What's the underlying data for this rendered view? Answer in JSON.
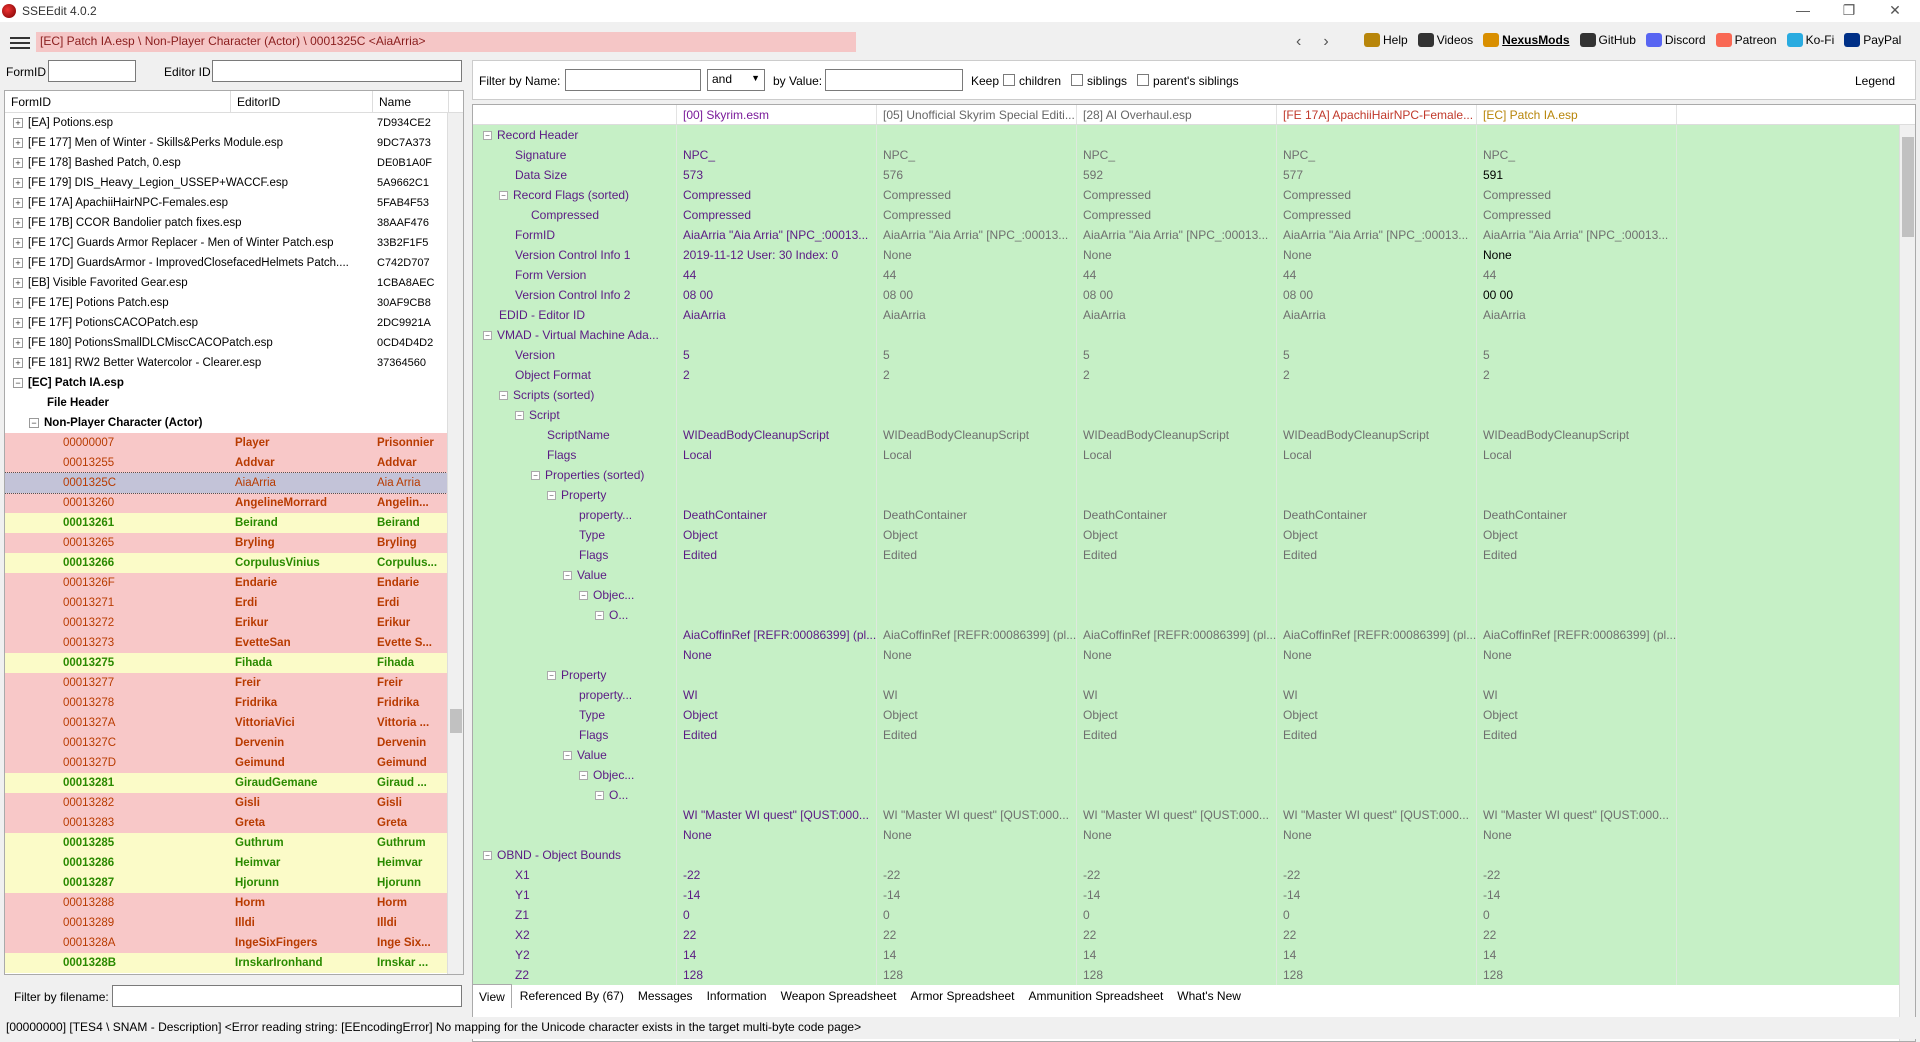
{
  "window": {
    "title": "SSEEdit 4.0.2",
    "min": "—",
    "max": "❐",
    "close": "✕"
  },
  "toolbar": {
    "path": "[EC] Patch IA.esp \\ Non-Player Character (Actor) \\ 0001325C <AiaArria>",
    "back": "‹",
    "forward": "›",
    "links": [
      {
        "label": "Help",
        "icon": "book-icon",
        "color": "#b8860b"
      },
      {
        "label": "Videos",
        "icon": "video-icon",
        "color": "#333"
      },
      {
        "label": "NexusMods",
        "icon": "nexus-icon",
        "color": "#d98f00"
      },
      {
        "label": "GitHub",
        "icon": "github-icon",
        "color": "#333"
      },
      {
        "label": "Discord",
        "icon": "discord-icon",
        "color": "#5865f2"
      },
      {
        "label": "Patreon",
        "icon": "patreon-icon",
        "color": "#f96854"
      },
      {
        "label": "Ko-Fi",
        "icon": "kofi-icon",
        "color": "#29abe0"
      },
      {
        "label": "PayPal",
        "icon": "paypal-icon",
        "color": "#003087"
      }
    ]
  },
  "left": {
    "formid_label": "FormID",
    "editorid_label": "Editor ID",
    "cols": [
      "FormID",
      "EditorID",
      "Name"
    ],
    "rows": [
      {
        "t": "p",
        "a": "[EA] Potions.esp",
        "c": "7D934CE2"
      },
      {
        "t": "p",
        "a": "[FE 177] Men of Winter - Skills&Perks Module.esp",
        "c": "9DC7A373"
      },
      {
        "t": "p",
        "a": "[FE 178] Bashed Patch, 0.esp",
        "c": "DE0B1A0F"
      },
      {
        "t": "p",
        "a": "[FE 179] DIS_Heavy_Legion_USSEP+WACCF.esp",
        "c": "5A9662C1"
      },
      {
        "t": "p",
        "a": "[FE 17A] ApachiiHairNPC-Females.esp",
        "c": "5FAB4F53"
      },
      {
        "t": "p",
        "a": "[FE 17B] CCOR Bandolier patch fixes.esp",
        "c": "38AAF476"
      },
      {
        "t": "p",
        "a": "[FE 17C] Guards Armor Replacer - Men of Winter Patch.esp",
        "c": "33B2F1F5"
      },
      {
        "t": "p",
        "a": "[FE 17D] GuardsArmor - ImprovedClosefacedHelmets Patch....",
        "c": "C742D707"
      },
      {
        "t": "p",
        "a": "[EB] Visible Favorited Gear.esp",
        "c": "1CBA8AEC"
      },
      {
        "t": "p",
        "a": "[FE 17E] Potions Patch.esp",
        "c": "30AF9CB8"
      },
      {
        "t": "p",
        "a": "[FE 17F] PotionsCACOPatch.esp",
        "c": "2DC9921A"
      },
      {
        "t": "p",
        "a": "[FE 180] PotionsSmallDLCMiscCACOPatch.esp",
        "c": "0CD4D4D2"
      },
      {
        "t": "p",
        "a": "[FE 181] RW2 Better Watercolor - Clearer.esp",
        "c": "37364560"
      },
      {
        "t": "o",
        "a": "[EC] Patch IA.esp",
        "c": ""
      },
      {
        "t": "h",
        "a": "File Header",
        "c": ""
      },
      {
        "t": "g",
        "a": "Non-Player Character (Actor)",
        "c": ""
      },
      {
        "t": "r",
        "a": "00000007",
        "b": "Player",
        "c": "Prisonnier"
      },
      {
        "t": "r",
        "a": "00013255",
        "b": "Addvar",
        "c": "Addvar"
      },
      {
        "t": "s",
        "a": "0001325C",
        "b": "AiaArria",
        "c": "Aia Arria"
      },
      {
        "t": "r",
        "a": "00013260",
        "b": "AngelineMorrard",
        "c": "Angelin..."
      },
      {
        "t": "y",
        "a": "00013261",
        "b": "Beirand",
        "c": "Beirand"
      },
      {
        "t": "r",
        "a": "00013265",
        "b": "Bryling",
        "c": "Bryling"
      },
      {
        "t": "y",
        "a": "00013266",
        "b": "CorpulusVinius",
        "c": "Corpulus..."
      },
      {
        "t": "r",
        "a": "0001326F",
        "b": "Endarie",
        "c": "Endarie"
      },
      {
        "t": "r",
        "a": "00013271",
        "b": "Erdi",
        "c": "Erdi"
      },
      {
        "t": "r",
        "a": "00013272",
        "b": "Erikur",
        "c": "Érikur"
      },
      {
        "t": "r",
        "a": "00013273",
        "b": "EvetteSan",
        "c": "Evette S..."
      },
      {
        "t": "y",
        "a": "00013275",
        "b": "Fihada",
        "c": "Fihada"
      },
      {
        "t": "r",
        "a": "00013277",
        "b": "Freir",
        "c": "Freir"
      },
      {
        "t": "r",
        "a": "00013278",
        "b": "Fridrika",
        "c": "Fridrika"
      },
      {
        "t": "r",
        "a": "0001327A",
        "b": "VittoriaVici",
        "c": "Vittoria ..."
      },
      {
        "t": "r",
        "a": "0001327C",
        "b": "Dervenin",
        "c": "Dervenin"
      },
      {
        "t": "r",
        "a": "0001327D",
        "b": "Geimund",
        "c": "Geimund"
      },
      {
        "t": "y",
        "a": "00013281",
        "b": "GiraudGemane",
        "c": "Giraud ..."
      },
      {
        "t": "r",
        "a": "00013282",
        "b": "Gisli",
        "c": "Gisli"
      },
      {
        "t": "r",
        "a": "00013283",
        "b": "Greta",
        "c": "Greta"
      },
      {
        "t": "y",
        "a": "00013285",
        "b": "Guthrum",
        "c": "Guthrum"
      },
      {
        "t": "y",
        "a": "00013286",
        "b": "Heimvar",
        "c": "Heimvar"
      },
      {
        "t": "y",
        "a": "00013287",
        "b": "Hjorunn",
        "c": "Hjorunn"
      },
      {
        "t": "r",
        "a": "00013288",
        "b": "Horm",
        "c": "Horm"
      },
      {
        "t": "r",
        "a": "00013289",
        "b": "Illdi",
        "c": "Illdi"
      },
      {
        "t": "r",
        "a": "0001328A",
        "b": "IngeSixFingers",
        "c": "Inge Six..."
      },
      {
        "t": "y",
        "a": "0001328B",
        "b": "IrnskarIronhand",
        "c": "Irnskar ..."
      }
    ],
    "filter_label": "Filter by filename:"
  },
  "right": {
    "filter_name_label": "Filter by Name:",
    "and_value": "and",
    "by_value_label": "by Value:",
    "keep_label": "Keep",
    "children_label": "children",
    "siblings_label": "siblings",
    "parents_label": "parent's siblings",
    "legend": "Legend",
    "headers": [
      "[00] Skyrim.esm",
      "[05] Unofficial Skyrim Special Editi...",
      "[28] AI Overhaul.esp",
      "[FE 17A] ApachiiHairNPC-Female...",
      "[EC] Patch IA.esp"
    ],
    "rows": [
      {
        "n": "Record Header",
        "d": 0,
        "e": "−",
        "v": [
          "",
          "",
          "",
          "",
          ""
        ]
      },
      {
        "n": "Signature",
        "d": 1,
        "e": "",
        "v": [
          "NPC_",
          "NPC_",
          "NPC_",
          "NPC_",
          "NPC_"
        ]
      },
      {
        "n": "Data Size",
        "d": 1,
        "e": "",
        "v": [
          "573",
          "576",
          "592",
          "577",
          "591"
        ]
      },
      {
        "n": "Record Flags (sorted)",
        "d": 1,
        "e": "−",
        "v": [
          "Compressed",
          "Compressed",
          "Compressed",
          "Compressed",
          "Compressed"
        ]
      },
      {
        "n": "Compressed",
        "d": 2,
        "e": "",
        "v": [
          "Compressed",
          "Compressed",
          "Compressed",
          "Compressed",
          "Compressed"
        ]
      },
      {
        "n": "FormID",
        "d": 1,
        "e": "",
        "v": [
          "AiaArria \"Aia Arria\" [NPC_:00013...",
          "AiaArria \"Aia Arria\" [NPC_:00013...",
          "AiaArria \"Aia Arria\" [NPC_:00013...",
          "AiaArria \"Aia Arria\" [NPC_:00013...",
          "AiaArria \"Aia Arria\" [NPC_:00013..."
        ]
      },
      {
        "n": "Version Control Info 1",
        "d": 1,
        "e": "",
        "v": [
          "2019-11-12 User: 30 Index: 0",
          "None",
          "None",
          "None",
          "None"
        ]
      },
      {
        "n": "Form Version",
        "d": 1,
        "e": "",
        "v": [
          "44",
          "44",
          "44",
          "44",
          "44"
        ]
      },
      {
        "n": "Version Control Info 2",
        "d": 1,
        "e": "",
        "v": [
          "08 00",
          "08 00",
          "08 00",
          "08 00",
          "00 00"
        ]
      },
      {
        "n": "EDID - Editor ID",
        "d": 0,
        "e": "",
        "v": [
          "AiaArria",
          "AiaArria",
          "AiaArria",
          "AiaArria",
          "AiaArria"
        ]
      },
      {
        "n": "VMAD - Virtual Machine Ada...",
        "d": 0,
        "e": "−",
        "v": [
          "",
          "",
          "",
          "",
          ""
        ]
      },
      {
        "n": "Version",
        "d": 1,
        "e": "",
        "v": [
          "5",
          "5",
          "5",
          "5",
          "5"
        ]
      },
      {
        "n": "Object Format",
        "d": 1,
        "e": "",
        "v": [
          "2",
          "2",
          "2",
          "2",
          "2"
        ]
      },
      {
        "n": "Scripts (sorted)",
        "d": 1,
        "e": "−",
        "v": [
          "",
          "",
          "",
          "",
          ""
        ]
      },
      {
        "n": "Script",
        "d": 2,
        "e": "−",
        "v": [
          "",
          "",
          "",
          "",
          ""
        ]
      },
      {
        "n": "ScriptName",
        "d": 3,
        "e": "",
        "v": [
          "WIDeadBodyCleanupScript",
          "WIDeadBodyCleanupScript",
          "WIDeadBodyCleanupScript",
          "WIDeadBodyCleanupScript",
          "WIDeadBodyCleanupScript"
        ]
      },
      {
        "n": "Flags",
        "d": 3,
        "e": "",
        "v": [
          "Local",
          "Local",
          "Local",
          "Local",
          "Local"
        ]
      },
      {
        "n": "Properties (sorted)",
        "d": 3,
        "e": "−",
        "v": [
          "",
          "",
          "",
          "",
          ""
        ]
      },
      {
        "n": "Property",
        "d": 4,
        "e": "−",
        "v": [
          "",
          "",
          "",
          "",
          ""
        ]
      },
      {
        "n": "property...",
        "d": 5,
        "e": "",
        "v": [
          "DeathContainer",
          "DeathContainer",
          "DeathContainer",
          "DeathContainer",
          "DeathContainer"
        ]
      },
      {
        "n": "Type",
        "d": 5,
        "e": "",
        "v": [
          "Object",
          "Object",
          "Object",
          "Object",
          "Object"
        ]
      },
      {
        "n": "Flags",
        "d": 5,
        "e": "",
        "v": [
          "Edited",
          "Edited",
          "Edited",
          "Edited",
          "Edited"
        ]
      },
      {
        "n": "Value",
        "d": 5,
        "e": "−",
        "v": [
          "",
          "",
          "",
          "",
          ""
        ]
      },
      {
        "n": "Objec...",
        "d": 6,
        "e": "−",
        "v": [
          "",
          "",
          "",
          "",
          ""
        ]
      },
      {
        "n": "O...",
        "d": 7,
        "e": "−",
        "v": [
          "",
          "",
          "",
          "",
          ""
        ]
      },
      {
        "n": "",
        "d": 8,
        "e": "",
        "v": [
          "AiaCoffinRef [REFR:00086399] (pl...",
          "AiaCoffinRef [REFR:00086399] (pl...",
          "AiaCoffinRef [REFR:00086399] (pl...",
          "AiaCoffinRef [REFR:00086399] (pl...",
          "AiaCoffinRef [REFR:00086399] (pl..."
        ]
      },
      {
        "n": "",
        "d": 8,
        "e": "",
        "v": [
          "None",
          "None",
          "None",
          "None",
          "None"
        ]
      },
      {
        "n": "Property",
        "d": 4,
        "e": "−",
        "v": [
          "",
          "",
          "",
          "",
          ""
        ]
      },
      {
        "n": "property...",
        "d": 5,
        "e": "",
        "v": [
          "WI",
          "WI",
          "WI",
          "WI",
          "WI"
        ]
      },
      {
        "n": "Type",
        "d": 5,
        "e": "",
        "v": [
          "Object",
          "Object",
          "Object",
          "Object",
          "Object"
        ]
      },
      {
        "n": "Flags",
        "d": 5,
        "e": "",
        "v": [
          "Edited",
          "Edited",
          "Edited",
          "Edited",
          "Edited"
        ]
      },
      {
        "n": "Value",
        "d": 5,
        "e": "−",
        "v": [
          "",
          "",
          "",
          "",
          ""
        ]
      },
      {
        "n": "Objec...",
        "d": 6,
        "e": "−",
        "v": [
          "",
          "",
          "",
          "",
          ""
        ]
      },
      {
        "n": "O...",
        "d": 7,
        "e": "−",
        "v": [
          "",
          "",
          "",
          "",
          ""
        ]
      },
      {
        "n": "",
        "d": 8,
        "e": "",
        "v": [
          "WI \"Master WI quest\" [QUST:000...",
          "WI \"Master WI quest\" [QUST:000...",
          "WI \"Master WI quest\" [QUST:000...",
          "WI \"Master WI quest\" [QUST:000...",
          "WI \"Master WI quest\" [QUST:000..."
        ]
      },
      {
        "n": "",
        "d": 8,
        "e": "",
        "v": [
          "None",
          "None",
          "None",
          "None",
          "None"
        ]
      },
      {
        "n": "OBND - Object Bounds",
        "d": 0,
        "e": "−",
        "v": [
          "",
          "",
          "",
          "",
          ""
        ]
      },
      {
        "n": "X1",
        "d": 1,
        "e": "",
        "v": [
          "-22",
          "-22",
          "-22",
          "-22",
          "-22"
        ]
      },
      {
        "n": "Y1",
        "d": 1,
        "e": "",
        "v": [
          "-14",
          "-14",
          "-14",
          "-14",
          "-14"
        ]
      },
      {
        "n": "Z1",
        "d": 1,
        "e": "",
        "v": [
          "0",
          "0",
          "0",
          "0",
          "0"
        ]
      },
      {
        "n": "X2",
        "d": 1,
        "e": "",
        "v": [
          "22",
          "22",
          "22",
          "22",
          "22"
        ]
      },
      {
        "n": "Y2",
        "d": 1,
        "e": "",
        "v": [
          "14",
          "14",
          "14",
          "14",
          "14"
        ]
      },
      {
        "n": "Z2",
        "d": 1,
        "e": "",
        "v": [
          "128",
          "128",
          "128",
          "128",
          "128"
        ]
      }
    ],
    "tabs": [
      "View",
      "Referenced By (67)",
      "Messages",
      "Information",
      "Weapon Spreadsheet",
      "Armor Spreadsheet",
      "Ammunition Spreadsheet",
      "What's New"
    ]
  },
  "status": "[00000000] [TES4 \\ SNAM - Description] <Error reading string: [EEncodingError] No mapping for the Unicode character exists in the target multi-byte code page>"
}
